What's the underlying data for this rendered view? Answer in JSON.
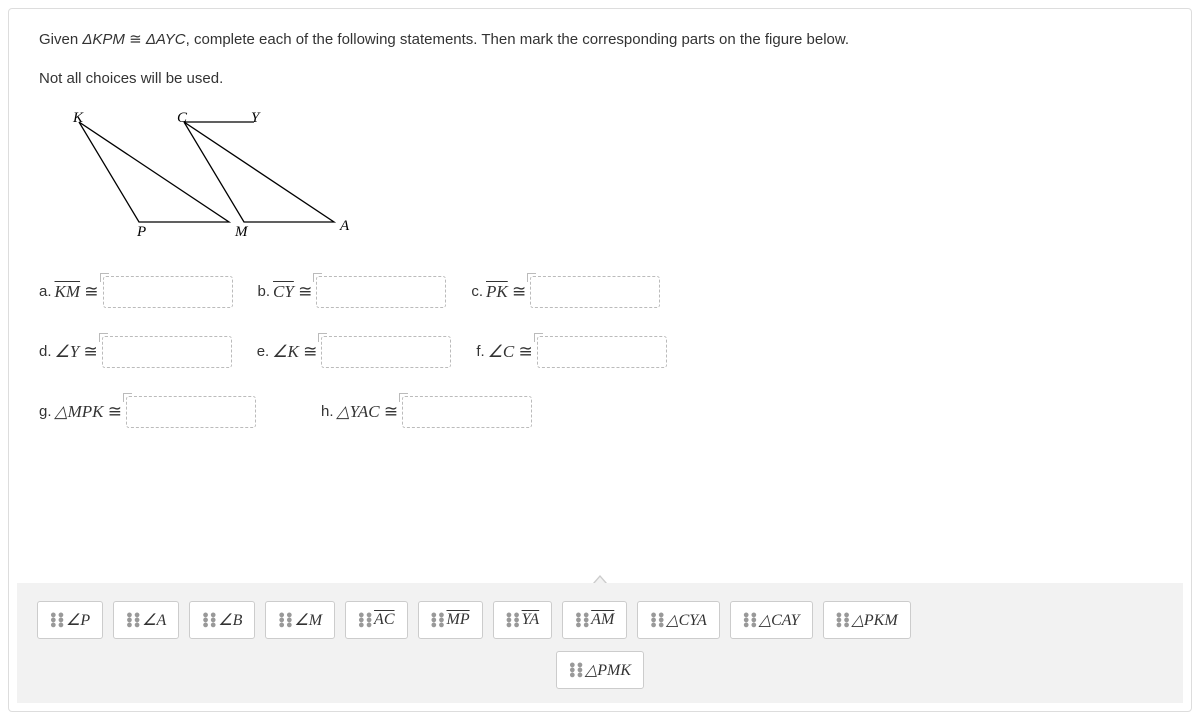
{
  "prompt_pre": "Given ",
  "prompt_congruence_left": "ΔKPM",
  "prompt_congruence_sym": " ≅ ",
  "prompt_congruence_right": "ΔAYC",
  "prompt_post": ", complete each of the following statements.  Then mark the corresponding parts on the figure below.",
  "note": "Not all choices will be used.",
  "figure": {
    "K": "K",
    "C": "C",
    "Y": "Y",
    "P": "P",
    "M": "M",
    "A": "A"
  },
  "statements": {
    "a": {
      "id": "a.",
      "text": "KM",
      "type": "seg"
    },
    "b": {
      "id": "b.",
      "text": "CY",
      "type": "seg"
    },
    "c": {
      "id": "c.",
      "text": "PK",
      "type": "seg"
    },
    "d": {
      "id": "d.",
      "text": "∠Y",
      "type": "ang"
    },
    "e": {
      "id": "e.",
      "text": "∠K",
      "type": "ang"
    },
    "f": {
      "id": "f.",
      "text": "∠C",
      "type": "ang"
    },
    "g": {
      "id": "g.",
      "text": "△MPK",
      "type": "tri"
    },
    "h": {
      "id": "h.",
      "text": "△YAC",
      "type": "tri"
    }
  },
  "cong": "≅",
  "choices": {
    "r1": [
      "∠P",
      "∠A",
      "∠B",
      "∠M",
      "AC",
      "MP",
      "YA",
      "AM",
      "△CYA",
      "△CAY",
      "△PKM"
    ],
    "r2": [
      "△PMK"
    ]
  },
  "choice_types": {
    "r1": [
      "ang",
      "ang",
      "ang",
      "ang",
      "seg",
      "seg",
      "seg",
      "seg",
      "tri",
      "tri",
      "tri"
    ],
    "r2": [
      "tri"
    ]
  }
}
